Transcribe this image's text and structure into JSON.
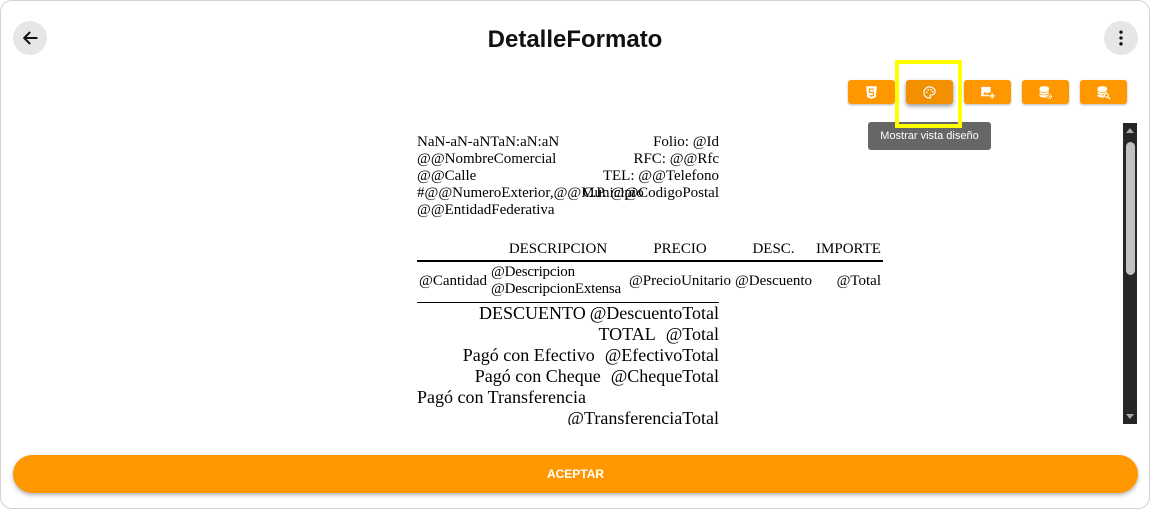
{
  "header": {
    "title": "DetalleFormato",
    "back_icon": "arrow-left-icon",
    "menu_icon": "more-vertical-icon"
  },
  "toolbar": {
    "buttons": [
      {
        "icon": "html5-icon"
      },
      {
        "icon": "palette-icon"
      },
      {
        "icon": "image-plus-icon"
      },
      {
        "icon": "database-cog-icon"
      },
      {
        "icon": "database-search-icon"
      }
    ],
    "tooltip": "Mostrar vista diseño"
  },
  "document": {
    "header_lines": [
      {
        "left": "NaN-aN-aNTaN:aN:aN",
        "right": "Folio: @Id"
      },
      {
        "left": "@@NombreComercial",
        "right": "RFC: @@Rfc"
      },
      {
        "left": "@@Calle",
        "right": "TEL: @@Telefono"
      },
      {
        "left": "#@@NumeroExterior,@@Municipio",
        "right": "C.P. @@CodigoPostal"
      },
      {
        "left": "@@EntidadFederativa"
      }
    ],
    "table": {
      "columns": [
        "DESCRIPCION",
        "PRECIO",
        "DESC.",
        "IMPORTE"
      ],
      "row": {
        "cantidad": "@Cantidad",
        "descripcion": "@Descripcion",
        "descripcion_extensa": "@DescripcionExtensa",
        "precio_unitario": "@PrecioUnitario",
        "descuento": "@Descuento",
        "total": "@Total"
      }
    },
    "totals": [
      {
        "label": "DESCUENTO",
        "value": "@DescuentoTotal"
      },
      {
        "label": "TOTAL",
        "value": "@Total"
      },
      {
        "label": "Pagó con Efectivo",
        "value": "@EfectivoTotal"
      },
      {
        "label": "Pagó con Cheque",
        "value": "@ChequeTotal"
      },
      {
        "label": "Pagó con Transferencia",
        "value": "@TransferenciaTotal"
      }
    ]
  },
  "scrollbar": {
    "position": 0
  },
  "footer": {
    "accept_label": "ACEPTAR"
  },
  "colors": {
    "accent": "#ff9800",
    "highlight": "#ffff00",
    "tooltip": "#666666",
    "scrollbar_track": "#262626",
    "scrollbar_thumb": "#c1c1c1"
  }
}
